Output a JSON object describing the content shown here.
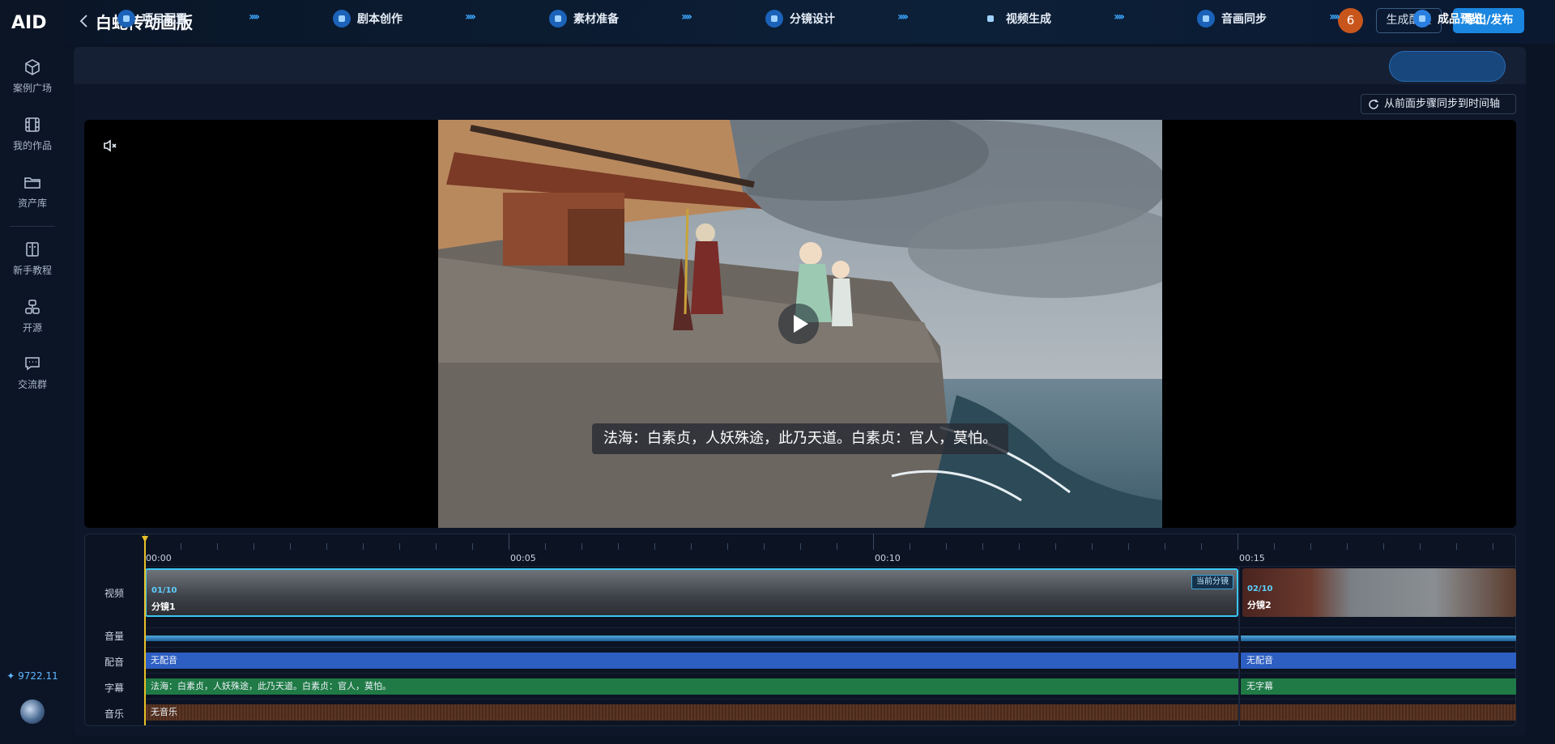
{
  "app": {
    "logo_text": "AID",
    "title": "白蛇传动画版"
  },
  "sidebar": {
    "items": [
      {
        "label": "案例广场",
        "icon": "cube-icon"
      },
      {
        "label": "我的作品",
        "icon": "film-icon"
      },
      {
        "label": "资产库",
        "icon": "folder-icon"
      },
      {
        "label": "新手教程",
        "icon": "book-icon"
      },
      {
        "label": "开源",
        "icon": "share-icon"
      },
      {
        "label": "交流群",
        "icon": "chat-icon"
      }
    ],
    "credits": "9722.11"
  },
  "header": {
    "notification_count": "6",
    "config_label": "生成配置",
    "export_label": "导出/发布"
  },
  "steps": [
    {
      "label": "项目配置",
      "icon": "gear-icon"
    },
    {
      "label": "剧本创作",
      "icon": "wand-icon"
    },
    {
      "label": "素材准备",
      "icon": "image-icon"
    },
    {
      "label": "分镜设计",
      "icon": "layout-icon"
    },
    {
      "label": "视频生成",
      "icon": "spinner-icon"
    },
    {
      "label": "音画同步",
      "icon": "mic-icon"
    },
    {
      "label": "成品预览",
      "icon": "video-icon",
      "active": true
    }
  ],
  "sync_label": "从前面步骤同步到时间轴",
  "player": {
    "subtitle": "法海：白素贞，人妖殊途，此乃天道。白素贞：官人，莫怕。"
  },
  "timeline": {
    "ruler_labels": [
      "00:00",
      "00:05",
      "00:10",
      "00:15"
    ],
    "row_labels": {
      "video": "视频",
      "volume": "音量",
      "dub": "配音",
      "subtitle": "字幕",
      "music": "音乐"
    },
    "clips": [
      {
        "index": "01/10",
        "name": "分镜1",
        "current_tag": "当前分镜",
        "dub": "无配音",
        "subtitle": "法海：白素贞，人妖殊途，此乃天道。白素贞：官人，莫怕。",
        "music": "无音乐"
      },
      {
        "index": "02/10",
        "name": "分镜2",
        "dub": "无配音",
        "subtitle": "无字幕"
      }
    ]
  },
  "colors": {
    "accent": "#1a86e0",
    "playhead": "#e8c028",
    "dub_track": "#2d5ec2",
    "subtitle_track": "#1f7a45",
    "clip_border": "#3ac6f0"
  }
}
